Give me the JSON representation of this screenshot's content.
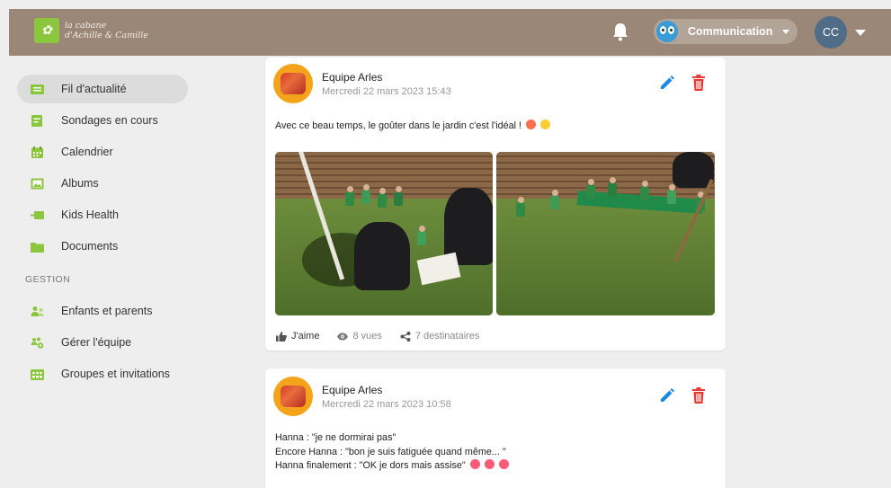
{
  "header": {
    "logo_text_line1": "la cabane",
    "logo_text_line2": "d'Achille & Camille",
    "account_label": "Communication",
    "user_initials": "CC"
  },
  "sidebar": {
    "items": [
      {
        "label": "Fil d'actualité",
        "icon": "news-feed-icon",
        "active": true
      },
      {
        "label": "Sondages en cours",
        "icon": "poll-icon"
      },
      {
        "label": "Calendrier",
        "icon": "calendar-icon"
      },
      {
        "label": "Albums",
        "icon": "album-icon"
      },
      {
        "label": "Kids Health",
        "icon": "kids-health-icon"
      },
      {
        "label": "Documents",
        "icon": "folder-icon"
      }
    ],
    "section_label": "GESTION",
    "management_items": [
      {
        "label": "Enfants et parents",
        "icon": "people-icon"
      },
      {
        "label": "Gérer l'équipe",
        "icon": "team-icon"
      },
      {
        "label": "Groupes et invitations",
        "icon": "groups-icon"
      }
    ]
  },
  "posts": [
    {
      "author": "Equipe Arles",
      "date": "Mercredi 22 mars 2023 15:43",
      "text": "Avec ce beau temps, le goûter dans le jardin c'est l'idéal !",
      "like_label": "J'aime",
      "views": "8 vues",
      "recipients": "7 destinataires"
    },
    {
      "author": "Equipe Arles",
      "date": "Mercredi 22 mars 2023 10:58",
      "lines": [
        "Hanna : \"je ne dormirai pas\"",
        "Encore Hanna : \"bon je suis fatiguée quand même... \"",
        "Hanna finalement : \"OK je dors mais assise\""
      ]
    }
  ],
  "colors": {
    "topbar": "#9a8777",
    "brand_green": "#8cc63f",
    "edit_blue": "#1e88e5",
    "delete_red": "#e53935",
    "avatar_orange": "#f3a41a"
  }
}
